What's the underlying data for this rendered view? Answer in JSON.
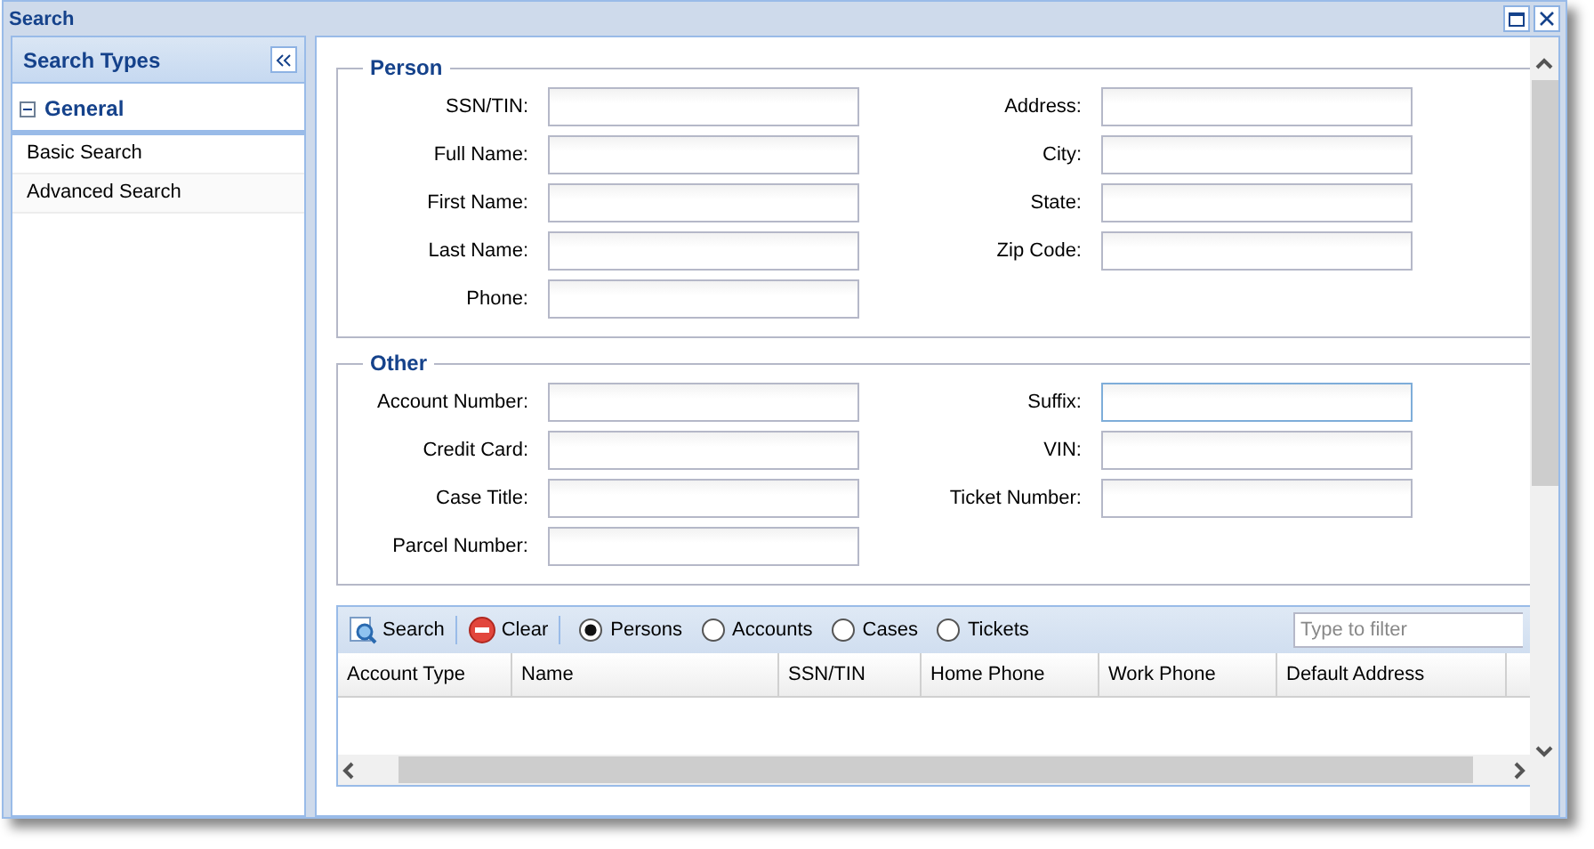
{
  "window": {
    "title": "Search"
  },
  "sidebar": {
    "title": "Search Types",
    "group": {
      "label": "General",
      "expanded": true,
      "items": [
        {
          "label": "Basic Search",
          "selected": false
        },
        {
          "label": "Advanced Search",
          "selected": false
        }
      ]
    }
  },
  "sections": [
    {
      "legend": "Person",
      "left": [
        {
          "label": "SSN/TIN:"
        },
        {
          "label": "Full Name:"
        },
        {
          "label": "First Name:"
        },
        {
          "label": "Last Name:"
        },
        {
          "label": "Phone:"
        }
      ],
      "right": [
        {
          "label": "Address:"
        },
        {
          "label": "City:"
        },
        {
          "label": "State:"
        },
        {
          "label": "Zip Code:"
        }
      ]
    },
    {
      "legend": "Other",
      "left": [
        {
          "label": "Account Number:"
        },
        {
          "label": "Credit Card:"
        },
        {
          "label": "Case Title:"
        },
        {
          "label": "Parcel Number:"
        }
      ],
      "right": [
        {
          "label": "Suffix:",
          "focused": true
        },
        {
          "label": "VIN:"
        },
        {
          "label": "Ticket Number:"
        }
      ]
    }
  ],
  "results": {
    "buttons": [
      {
        "kind": "search",
        "label": "Search"
      },
      {
        "kind": "clear",
        "label": "Clear"
      }
    ],
    "radios": [
      {
        "label": "Persons",
        "selected": true
      },
      {
        "label": "Accounts",
        "selected": false
      },
      {
        "label": "Cases",
        "selected": false
      },
      {
        "label": "Tickets",
        "selected": false
      }
    ],
    "filter": {
      "placeholder": "Type to filter"
    },
    "columns": [
      "Account Type",
      "Name",
      "SSN/TIN",
      "Home Phone",
      "Work Phone",
      "Default Address"
    ]
  }
}
